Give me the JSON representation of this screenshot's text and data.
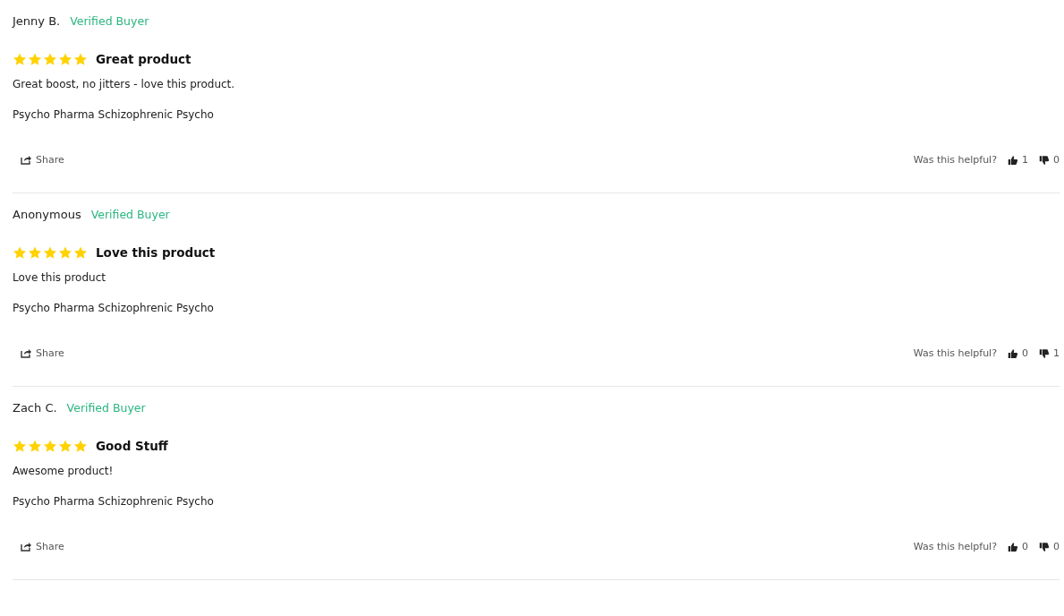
{
  "reviews": [
    {
      "author": "Jenny B.",
      "badge": "Verified Buyer",
      "stars": 5,
      "title": "Great product",
      "body": "Great boost, no jitters - love this product.",
      "product": "Psycho Pharma Schizophrenic Psycho",
      "share": "Share",
      "helpful_prompt": "Was this helpful?",
      "up_votes": "1",
      "down_votes": "0"
    },
    {
      "author": "Anonymous",
      "badge": "Verified Buyer",
      "stars": 5,
      "title": "Love this product",
      "body": "Love this product",
      "product": "Psycho Pharma Schizophrenic Psycho",
      "share": "Share",
      "helpful_prompt": "Was this helpful?",
      "up_votes": "0",
      "down_votes": "1"
    },
    {
      "author": "Zach C.",
      "badge": "Verified Buyer",
      "stars": 5,
      "title": "Good Stuff",
      "body": "Awesome product!",
      "product": "Psycho Pharma Schizophrenic Psycho",
      "share": "Share",
      "helpful_prompt": "Was this helpful?",
      "up_votes": "0",
      "down_votes": "0"
    }
  ]
}
